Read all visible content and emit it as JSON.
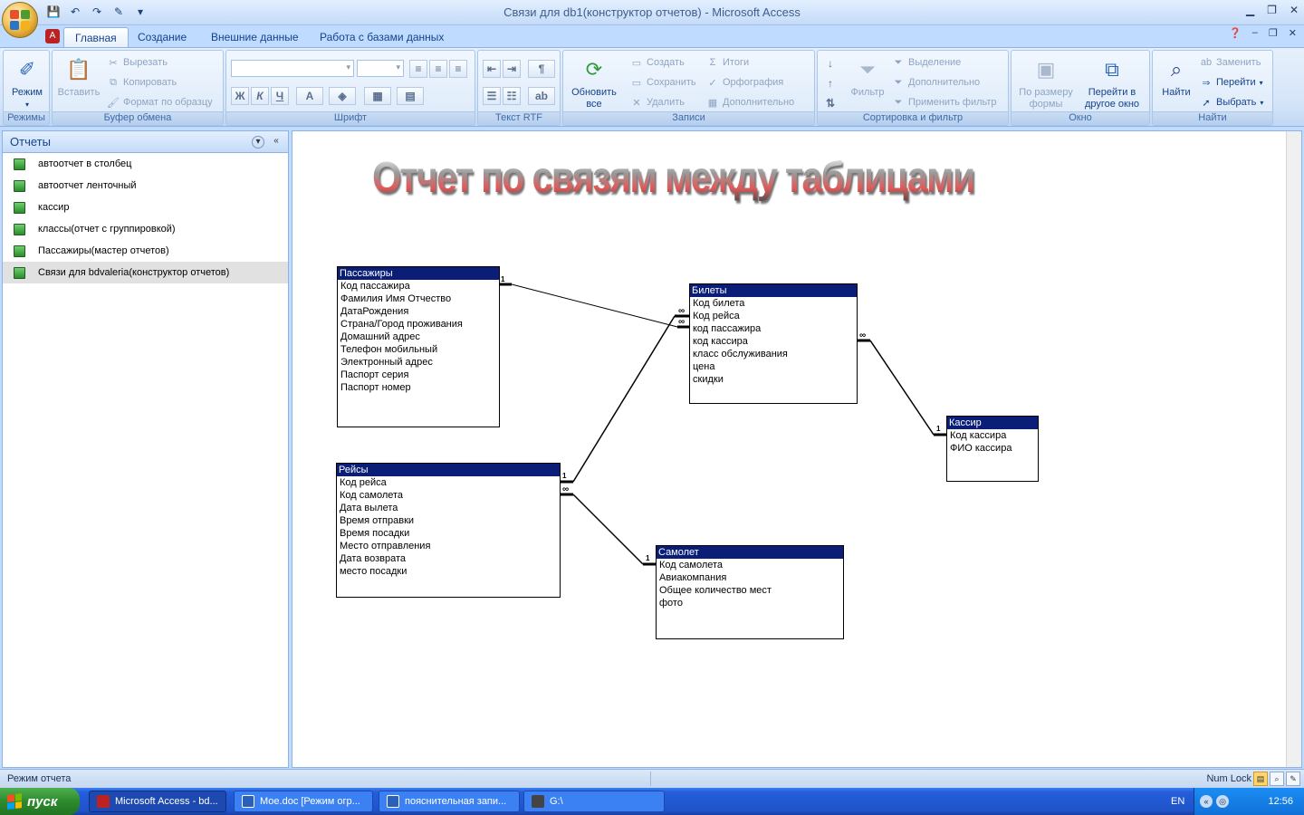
{
  "window": {
    "title": "Связи для db1(конструктор отчетов) - Microsoft Access"
  },
  "ribbon_tabs": [
    "Главная",
    "Создание",
    "Внешние данные",
    "Работа с базами данных"
  ],
  "ribbon": {
    "views": {
      "mode_label": "Режим",
      "group": "Режимы"
    },
    "clipboard": {
      "paste": "Вставить",
      "cut": "Вырезать",
      "copy": "Копировать",
      "format_painter": "Формат по образцу",
      "group": "Буфер обмена"
    },
    "font": {
      "bold": "Ж",
      "italic": "К",
      "underline": "Ч",
      "color": "A",
      "group": "Шрифт"
    },
    "rtf": {
      "group": "Текст RTF"
    },
    "records": {
      "refresh": "Обновить",
      "refresh2": "все",
      "new": "Создать",
      "save": "Сохранить",
      "delete": "Удалить",
      "totals": "Итоги",
      "spelling": "Орфография",
      "more": "Дополнительно",
      "group": "Записи"
    },
    "sort": {
      "filter": "Фильтр",
      "selection": "Выделение",
      "advanced": "Дополнительно",
      "toggle": "Применить фильтр",
      "group": "Сортировка и фильтр"
    },
    "window": {
      "fit": "По размеру",
      "fit2": "формы",
      "switch": "Перейти в",
      "switch2": "другое окно",
      "group": "Окно"
    },
    "find": {
      "find": "Найти",
      "replace": "Заменить",
      "goto": "Перейти",
      "select": "Выбрать",
      "group": "Найти"
    }
  },
  "nav_pane": {
    "header": "Отчеты",
    "items": [
      "автоотчет в столбец",
      "автоотчет ленточный",
      "кассир",
      "классы(отчет с группировкой)",
      "Пассажиры(мастер отчетов)",
      "Связи для bdvaleria(конструктор отчетов)"
    ]
  },
  "report": {
    "title": "Отчет по связям между таблицами",
    "tables": {
      "passengers": {
        "name": "Пассажиры",
        "fields": [
          "Код пассажира",
          "Фамилия Имя Отчество",
          "ДатаРождения",
          "Страна/Город проживания",
          "Домашний адрес",
          "Телефон мобильный",
          "Электронный адрес",
          "Паспорт серия",
          "Паспорт номер"
        ]
      },
      "tickets": {
        "name": "Билеты",
        "fields": [
          "Код билета",
          "Код рейса",
          "код пассажира",
          "код кассира",
          "класс обслуживания",
          "цена",
          "скидки"
        ]
      },
      "cashier": {
        "name": "Кассир",
        "fields": [
          "Код кассира",
          "ФИО кассира"
        ]
      },
      "flights": {
        "name": "Рейсы",
        "fields": [
          "Код рейса",
          "Код самолета",
          "Дата вылета",
          "Время отправки",
          "Время посадки",
          "Место отправления",
          "Дата возврата",
          "место посадки"
        ]
      },
      "plane": {
        "name": "Самолет",
        "fields": [
          "Код самолета",
          "Авиакомпания",
          "Общее количество мест",
          "фото"
        ]
      }
    },
    "cardinality": {
      "one": "1",
      "many": "∞"
    }
  },
  "statusbar": {
    "left": "Режим отчета",
    "right": "Num Lock"
  },
  "taskbar": {
    "start": "пуск",
    "tasks": [
      "Microsoft Access - bd...",
      "Мое.doc [Режим огр...",
      "пояснительная запи...",
      "G:\\"
    ],
    "lang": "EN",
    "clock": "12:56"
  },
  "colors": {
    "table_header": "#0a1e78",
    "ribbon_bg": "#bfdbff",
    "taskbar": "#245edb",
    "start": "#2d8a2d"
  }
}
